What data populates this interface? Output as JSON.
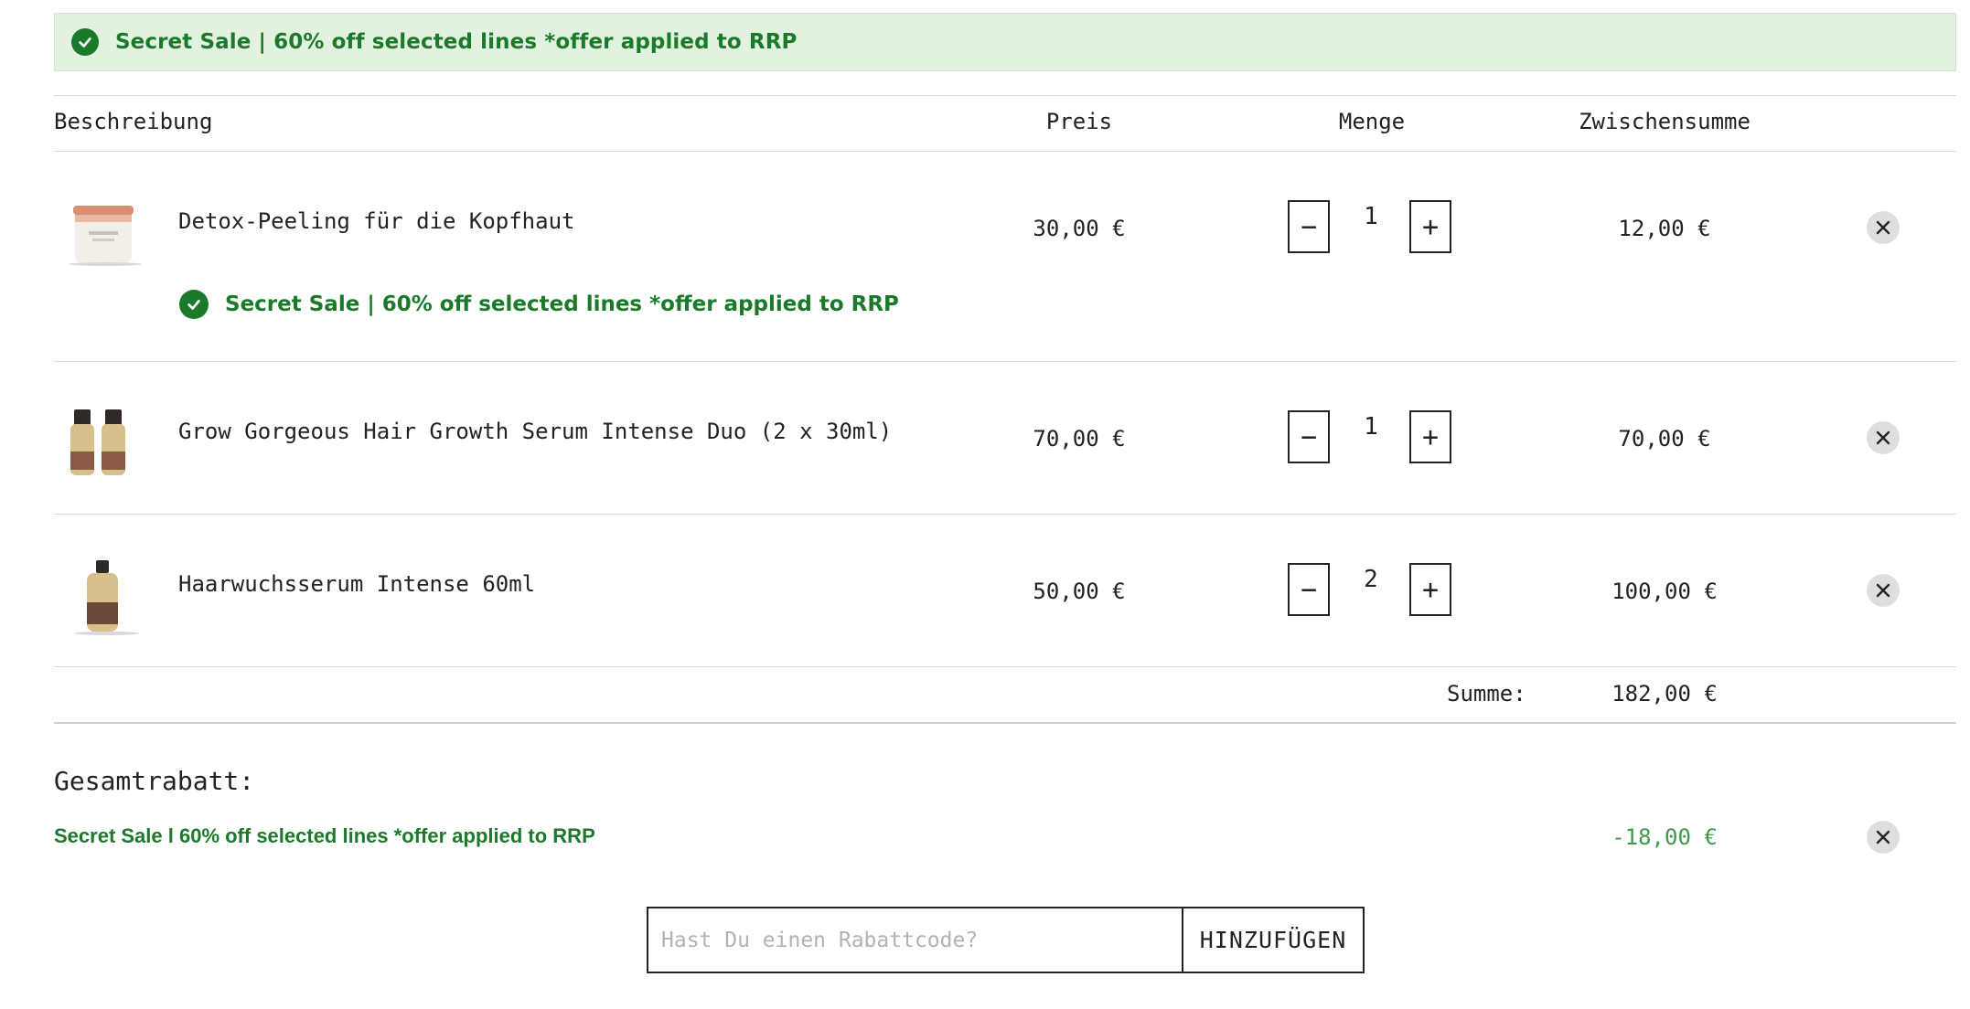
{
  "banner": {
    "text": "Secret Sale | 60% off selected lines *offer applied to RRP"
  },
  "columns": {
    "description": "Beschreibung",
    "price": "Preis",
    "quantity": "Menge",
    "subtotal": "Zwischensumme"
  },
  "items": [
    {
      "name": "Detox-Peeling für die Kopfhaut",
      "price": "30,00 €",
      "qty": "1",
      "subtotal": "12,00 €",
      "offer": "Secret Sale | 60% off selected lines *offer applied to RRP"
    },
    {
      "name": "Grow Gorgeous Hair Growth Serum Intense Duo (2 x 30ml)",
      "price": "70,00 €",
      "qty": "1",
      "subtotal": "70,00 €"
    },
    {
      "name": "Haarwuchsserum Intense 60ml",
      "price": "50,00 €",
      "qty": "2",
      "subtotal": "100,00 €"
    }
  ],
  "qty_controls": {
    "minus": "−",
    "plus": "+"
  },
  "summary": {
    "label": "Summe:",
    "value": "182,00 €"
  },
  "discount": {
    "heading": "Gesamtrabatt:",
    "name": "Secret Sale l 60% off selected lines *offer applied to RRP",
    "value": "-18,00 €"
  },
  "coupon": {
    "placeholder": "Hast Du einen Rabattcode?",
    "button": "HINZUFÜGEN"
  },
  "colors": {
    "accent_green": "#1b7a2a",
    "banner_bg": "#e3f1e1",
    "discount_green": "#3d9a4a"
  }
}
